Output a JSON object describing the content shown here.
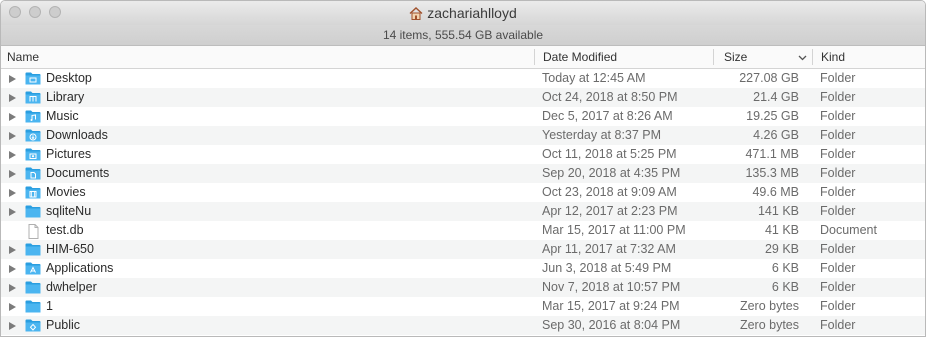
{
  "window": {
    "title": "zachariahlloyd",
    "status": "14 items, 555.54 GB available"
  },
  "columns": {
    "name": "Name",
    "date": "Date Modified",
    "size": "Size",
    "kind": "Kind"
  },
  "files": [
    {
      "name": "Desktop",
      "date": "Today at 12:45 AM",
      "size": "227.08 GB",
      "kind": "Folder",
      "icon": "desktop-folder-icon",
      "expandable": true
    },
    {
      "name": "Library",
      "date": "Oct 24, 2018 at 8:50 PM",
      "size": "21.4 GB",
      "kind": "Folder",
      "icon": "library-folder-icon",
      "expandable": true
    },
    {
      "name": "Music",
      "date": "Dec 5, 2017 at 8:26 AM",
      "size": "19.25 GB",
      "kind": "Folder",
      "icon": "music-folder-icon",
      "expandable": true
    },
    {
      "name": "Downloads",
      "date": "Yesterday at 8:37 PM",
      "size": "4.26 GB",
      "kind": "Folder",
      "icon": "downloads-folder-icon",
      "expandable": true
    },
    {
      "name": "Pictures",
      "date": "Oct 11, 2018 at 5:25 PM",
      "size": "471.1 MB",
      "kind": "Folder",
      "icon": "pictures-folder-icon",
      "expandable": true
    },
    {
      "name": "Documents",
      "date": "Sep 20, 2018 at 4:35 PM",
      "size": "135.3 MB",
      "kind": "Folder",
      "icon": "documents-folder-icon",
      "expandable": true
    },
    {
      "name": "Movies",
      "date": "Oct 23, 2018 at 9:09 AM",
      "size": "49.6 MB",
      "kind": "Folder",
      "icon": "movies-folder-icon",
      "expandable": true
    },
    {
      "name": "sqliteNu",
      "date": "Apr 12, 2017 at 2:23 PM",
      "size": "141 KB",
      "kind": "Folder",
      "icon": "folder-icon",
      "expandable": true
    },
    {
      "name": "test.db",
      "date": "Mar 15, 2017 at 11:00 PM",
      "size": "41 KB",
      "kind": "Document",
      "icon": "document-icon",
      "expandable": false
    },
    {
      "name": "HIM-650",
      "date": "Apr 11, 2017 at 7:32 AM",
      "size": "29 KB",
      "kind": "Folder",
      "icon": "folder-icon",
      "expandable": true
    },
    {
      "name": "Applications",
      "date": "Jun 3, 2018 at 5:49 PM",
      "size": "6 KB",
      "kind": "Folder",
      "icon": "applications-folder-icon",
      "expandable": true
    },
    {
      "name": "dwhelper",
      "date": "Nov 7, 2018 at 10:57 PM",
      "size": "6 KB",
      "kind": "Folder",
      "icon": "folder-icon",
      "expandable": true
    },
    {
      "name": "1",
      "date": "Mar 15, 2017 at 9:24 PM",
      "size": "Zero bytes",
      "kind": "Folder",
      "icon": "folder-icon",
      "expandable": true
    },
    {
      "name": "Public",
      "date": "Sep 30, 2016 at 8:04 PM",
      "size": "Zero bytes",
      "kind": "Folder",
      "icon": "public-folder-icon",
      "expandable": true
    }
  ],
  "colors": {
    "folder": "#4bb5f0",
    "folder_dark": "#2a9ee0",
    "alt_row": "#f4f5f5"
  }
}
